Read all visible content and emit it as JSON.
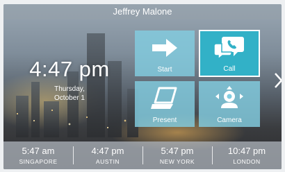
{
  "header": {
    "title": "Jeffrey Malone"
  },
  "clock": {
    "time": "4:47 pm",
    "day": "Thursday,",
    "date": "October 1"
  },
  "tiles": [
    {
      "label": "Start",
      "icon": "arrow-right-icon"
    },
    {
      "label": "Call",
      "icon": "chat-phone-icon",
      "selected": true
    },
    {
      "label": "Present",
      "icon": "laptop-icon"
    },
    {
      "label": "Camera",
      "icon": "camera-icon"
    }
  ],
  "navigation": {
    "next_icon": "chevron-right-icon"
  },
  "world_clocks": [
    {
      "time": "5:47 am",
      "city": "SINGAPORE"
    },
    {
      "time": "4:47 pm",
      "city": "AUSTIN"
    },
    {
      "time": "5:47 pm",
      "city": "NEW YORK"
    },
    {
      "time": "10:47 pm",
      "city": "LONDON"
    }
  ],
  "colors": {
    "tile": "#82cde1",
    "tile_selected": "#32b1c7",
    "text": "#ffffff"
  }
}
